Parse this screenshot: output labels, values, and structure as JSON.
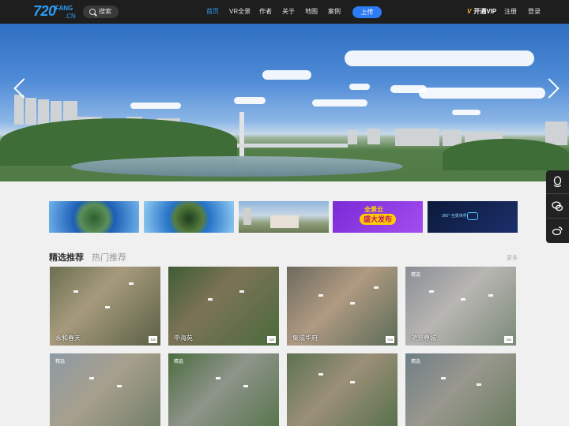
{
  "header": {
    "logo_main": "720",
    "logo_sub1": "FANG",
    "logo_sub2": ".CN",
    "search_label": "搜索",
    "nav": [
      "首页",
      "VR全景",
      "作者",
      "关于",
      "地图",
      "案例"
    ],
    "upload_label": "上传",
    "vip_label": "开通VIP",
    "register_label": "注册",
    "login_label": "登录",
    "accent_color": "#2d9cf5"
  },
  "banner": {
    "left_arrow": "chevron-left-icon",
    "right_arrow": "chevron-right-icon"
  },
  "sidebar": {
    "icons": [
      "qq-icon",
      "wechat-icon",
      "weibo-icon"
    ]
  },
  "thumbnails": [
    {
      "kind": "panorama-planet"
    },
    {
      "kind": "panorama-planet"
    },
    {
      "kind": "campus"
    },
    {
      "kind": "promo"
    },
    {
      "kind": "vr-promo"
    }
  ],
  "promo_text": {
    "line1": "全景云",
    "line2": "盛大发布",
    "vr_text": "360° 全景世界"
  },
  "section": {
    "tab_active": "精选推荐",
    "tab_inactive": "热门推荐",
    "more_label": "更多"
  },
  "cards": [
    {
      "title": "永和春天",
      "tag": ""
    },
    {
      "title": "中海苑",
      "tag": ""
    },
    {
      "title": "集成华府",
      "tag": ""
    },
    {
      "title": "滟景尊城",
      "tag": "精选"
    },
    {
      "title": "",
      "tag": "精选"
    },
    {
      "title": "",
      "tag": "精选"
    },
    {
      "title": "",
      "tag": ""
    },
    {
      "title": "",
      "tag": "精选"
    }
  ]
}
